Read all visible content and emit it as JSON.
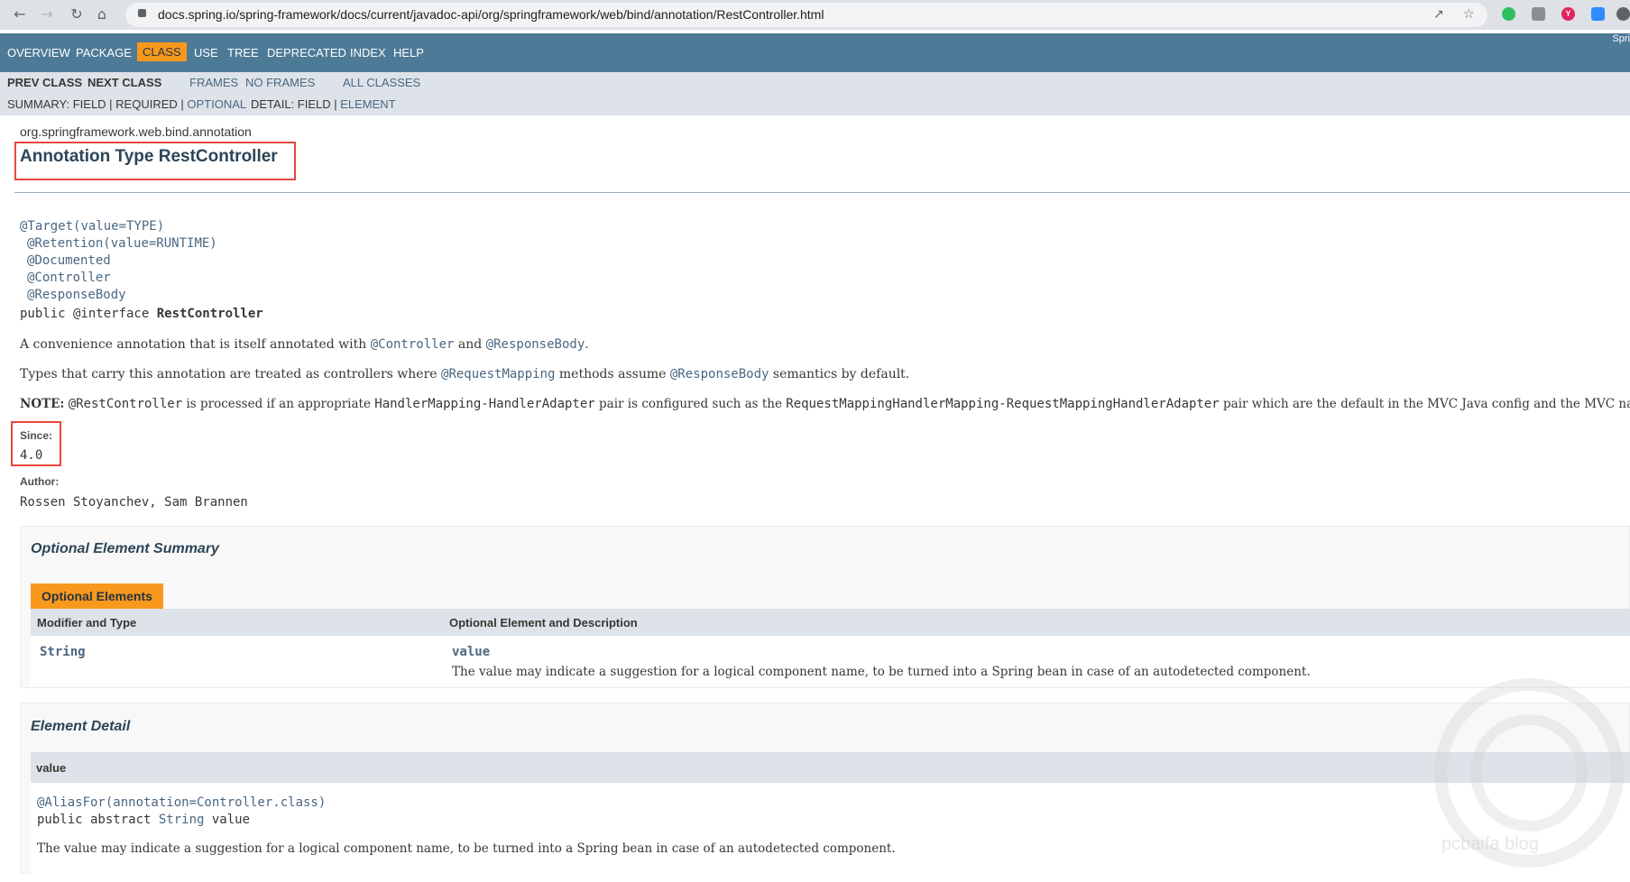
{
  "browser": {
    "url": "docs.spring.io/spring-framework/docs/current/javadoc-api/org/springframework/web/bind/annotation/RestController.html",
    "ext_labels": [
      "Y"
    ]
  },
  "topnav": {
    "items": [
      "OVERVIEW",
      "PACKAGE",
      "CLASS",
      "USE",
      "TREE",
      "DEPRECATED",
      "INDEX",
      "HELP"
    ],
    "active": "CLASS",
    "about": "Spri"
  },
  "subnav": {
    "prev_class": "PREV CLASS",
    "next_class": "NEXT CLASS",
    "frames": "FRAMES",
    "no_frames": "NO FRAMES",
    "all_classes": "ALL CLASSES",
    "summary_prefix": "SUMMARY: FIELD | REQUIRED | ",
    "summary_optional": "OPTIONAL",
    "detail_prefix": "DETAIL: FIELD | ",
    "detail_element": "ELEMENT"
  },
  "header": {
    "package": "org.springframework.web.bind.annotation",
    "title": "Annotation Type RestController"
  },
  "signature": {
    "lines": [
      {
        "annotation": "@Target",
        "args": "(value=TYPE)"
      },
      {
        "annotation": "@Retention",
        "args": "(value=RUNTIME)"
      },
      {
        "annotation": "@Documented",
        "args": ""
      },
      {
        "annotation": "@Controller",
        "args": ""
      },
      {
        "annotation": "@ResponseBody",
        "args": ""
      }
    ],
    "decl_prefix": "public @interface ",
    "decl_name": "RestController"
  },
  "description": {
    "p1_a": "A convenience annotation that is itself annotated with ",
    "p1_link1": "@Controller",
    "p1_b": " and ",
    "p1_link2": "@ResponseBody",
    "p1_c": ".",
    "p2_a": "Types that carry this annotation are treated as controllers where ",
    "p2_link1": "@RequestMapping",
    "p2_b": " methods assume ",
    "p2_link2": "@ResponseBody",
    "p2_c": " semantics by default.",
    "p3_note": "NOTE:",
    "p3_code1": "@RestController",
    "p3_a": " is processed if an appropriate ",
    "p3_code2": "HandlerMapping",
    "p3_dash": "-",
    "p3_code3": "HandlerAdapter",
    "p3_b": " pair is configured such as the ",
    "p3_code4": "RequestMappingHandlerMapping",
    "p3_code5": "RequestMappingHandlerAdapter",
    "p3_c": " pair which are the default in the MVC Java config and the MVC namespace."
  },
  "since": {
    "label": "Since:",
    "value": "4.0"
  },
  "author": {
    "label": "Author:",
    "value": "Rossen Stoyanchev, Sam Brannen"
  },
  "summary": {
    "heading": "Optional Element Summary",
    "tab": "Optional Elements",
    "col1": "Modifier and Type",
    "col2": "Optional Element and Description",
    "row_type": "String",
    "row_name": "value",
    "row_desc": "The value may indicate a suggestion for a logical component name, to be turned into a Spring bean in case of an autodetected component."
  },
  "detail": {
    "heading": "Element Detail",
    "member": "value",
    "alias": "@AliasFor",
    "alias_args": "(annotation=Controller.class)",
    "decl_prefix": "public abstract ",
    "decl_type": "String",
    "decl_name": " value",
    "desc": "The value may indicate a suggestion for a logical component name, to be turned into a Spring bean in case of an autodetected component."
  },
  "watermark": "pcbaifa blog"
}
